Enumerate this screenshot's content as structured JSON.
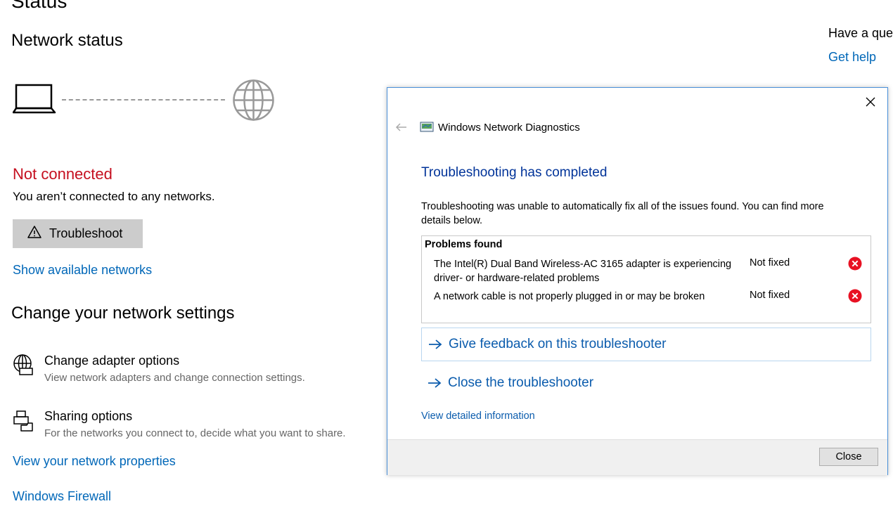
{
  "page": {
    "heading": "Status",
    "network_status_title": "Network status",
    "connection_state": "Not connected",
    "connection_desc": "You aren’t connected to any networks.",
    "troubleshoot_label": "Troubleshoot",
    "show_networks_link": "Show available networks",
    "change_settings_title": "Change your network settings",
    "options": [
      {
        "icon": "globe-adapter-icon",
        "title": "Change adapter options",
        "subtitle": "View network adapters and change connection settings."
      },
      {
        "icon": "sharing-icon",
        "title": "Sharing options",
        "subtitle": "For the networks you connect to, decide what you want to share."
      }
    ],
    "view_properties_link": "View your network properties",
    "firewall_link": "Windows Firewall"
  },
  "right_rail": {
    "question": "Have a question?",
    "get_help_link": "Get help"
  },
  "dialog": {
    "app_title": "Windows Network Diagnostics",
    "heading": "Troubleshooting has completed",
    "message": "Troubleshooting was unable to automatically fix all of the issues found. You can find more details below.",
    "problems_header": "Problems found",
    "problems": [
      {
        "text": "The Intel(R) Dual Band Wireless-AC 3165 adapter is experiencing driver- or hardware-related problems",
        "status": "Not fixed"
      },
      {
        "text": "A network cable is not properly plugged in or may be broken",
        "status": "Not fixed"
      }
    ],
    "feedback_link": "Give feedback on this troubleshooter",
    "close_troubleshooter_link": "Close the troubleshooter",
    "view_detailed_link": "View detailed information",
    "close_button": "Close"
  },
  "colors": {
    "error_red": "#c50f1f",
    "link_blue": "#0067b8",
    "dialog_heading_blue": "#003399",
    "error_icon_red": "#e81123"
  }
}
